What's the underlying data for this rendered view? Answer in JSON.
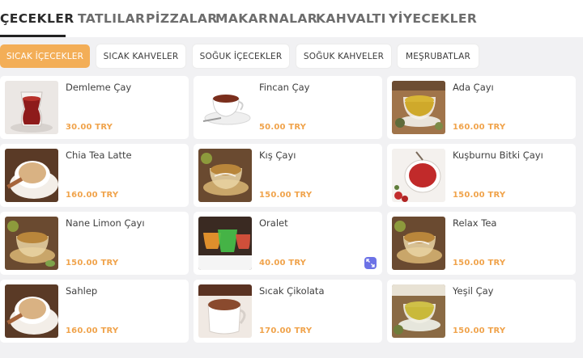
{
  "category_tabs": [
    {
      "label": "ÇECEKLER",
      "active": true
    },
    {
      "label": "TATLILAR",
      "active": false
    },
    {
      "label": "PİZZALAR",
      "active": false
    },
    {
      "label": "MAKARNALAR",
      "active": false
    },
    {
      "label": "KAHVALTI",
      "active": false
    },
    {
      "label": "YİYECEKLER",
      "active": false
    }
  ],
  "subcategories": [
    {
      "label": "SICAK İÇECEKLER",
      "active": true
    },
    {
      "label": "SICAK KAHVELER",
      "active": false
    },
    {
      "label": "SOĞUK İÇECEKLER",
      "active": false
    },
    {
      "label": "SOĞUK KAHVELER",
      "active": false
    },
    {
      "label": "MEŞRUBATLAR",
      "active": false
    }
  ],
  "products": [
    {
      "name": "Demleme Çay",
      "price": "30.00 TRY",
      "image_icon": "turkish-tea-glass"
    },
    {
      "name": "Fincan Çay",
      "price": "50.00 TRY",
      "image_icon": "tea-cup-saucer"
    },
    {
      "name": "Ada Çayı",
      "price": "160.00 TRY",
      "image_icon": "herbal-tea-cup"
    },
    {
      "name": "Chia Tea Latte",
      "price": "160.00 TRY",
      "image_icon": "latte-cup"
    },
    {
      "name": "Kış Çayı",
      "price": "150.00 TRY",
      "image_icon": "winter-tea-cup"
    },
    {
      "name": "Kuşburnu Bitki Çayı",
      "price": "150.00 TRY",
      "image_icon": "rosehip-tea-cup"
    },
    {
      "name": "Nane Limon Çayı",
      "price": "150.00 TRY",
      "image_icon": "mint-lemon-tea-cup"
    },
    {
      "name": "Oralet",
      "price": "40.00 TRY",
      "image_icon": "oralet-glasses"
    },
    {
      "name": "Relax Tea",
      "price": "150.00 TRY",
      "image_icon": "relax-tea-cup"
    },
    {
      "name": "Sahlep",
      "price": "160.00 TRY",
      "image_icon": "sahlep-cup"
    },
    {
      "name": "Sıcak Çikolata",
      "price": "170.00 TRY",
      "image_icon": "hot-chocolate-mug"
    },
    {
      "name": "Yeşil Çay",
      "price": "150.00 TRY",
      "image_icon": "green-tea-cup"
    }
  ],
  "expand_icon": "expand-arrows-icon",
  "colors": {
    "accent": "#f3ae57",
    "price": "#f0a34b",
    "expand_button": "#6c72e6"
  }
}
